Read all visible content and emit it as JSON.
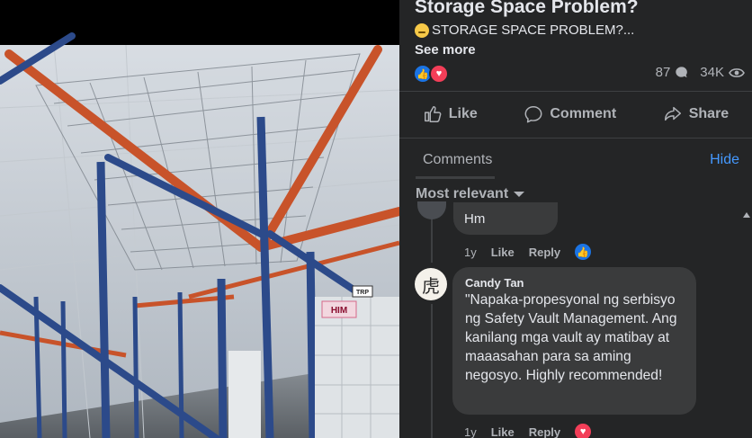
{
  "post": {
    "title": "Storage Space Problem?",
    "description": "STORAGE SPACE PROBLEM?...",
    "see_more": "See more",
    "comment_count": "87",
    "view_count": "34K",
    "reaction_icons": [
      "like-icon",
      "love-icon"
    ]
  },
  "video": {
    "signs": [
      "HIM",
      "TRP"
    ]
  },
  "actions": {
    "like": "Like",
    "comment": "Comment",
    "share": "Share"
  },
  "comments_header": {
    "tab": "Comments",
    "hide": "Hide",
    "sort": "Most relevant"
  },
  "comments": [
    {
      "text": "Hm",
      "age": "1y",
      "like": "Like",
      "reply": "Reply",
      "reaction": "like"
    },
    {
      "author": "Candy Tan",
      "avatar_glyph": "虎",
      "text": "\"Napaka-propesyonal ng serbisyo ng Safety Vault Management. Ang kanilang mga vault ay matibay at maaasahan para sa aming negosyo. Highly recommended!",
      "age": "1y",
      "like": "Like",
      "reply": "Reply",
      "reaction": "love"
    }
  ],
  "colors": {
    "background": "#242526",
    "bubble": "#3a3b3c",
    "accent_blue": "#4599ff",
    "like_blue": "#1b74e4",
    "love_red": "#f33e58",
    "text_primary": "#e4e6eb",
    "text_secondary": "#b0b3b8"
  }
}
